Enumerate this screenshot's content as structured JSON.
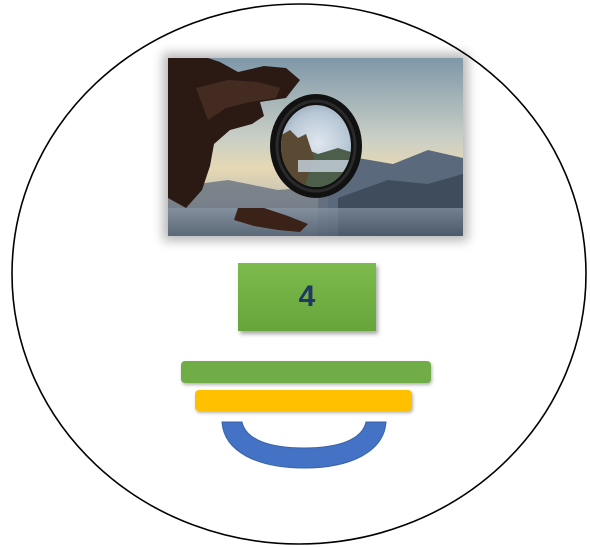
{
  "number_box": {
    "value": "4"
  },
  "colors": {
    "outline": "#000000",
    "number_box_fill": "#70ad47",
    "number_text": "#1f3864",
    "bar_top": "#70ad47",
    "bar_middle": "#ffc000",
    "cup_fill": "#4472c4"
  },
  "icons": {
    "photo": "hand-holding-lens-photo",
    "cup": "bowl-shape-icon"
  }
}
